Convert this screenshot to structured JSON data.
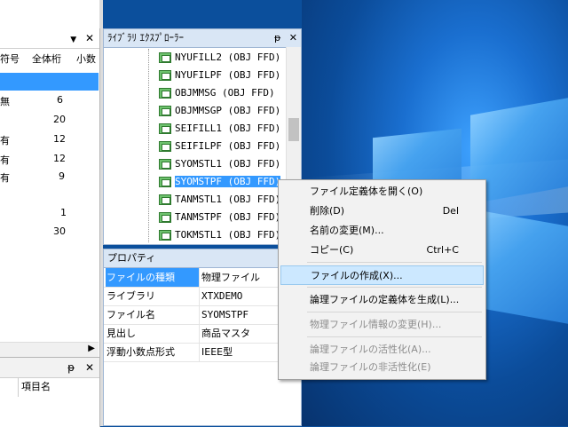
{
  "left_panel": {
    "pin": "▼",
    "close": "✕",
    "col_headers": [
      "符号",
      "全体桁",
      "小数"
    ],
    "rows": [
      {
        "c1": "",
        "c2": ""
      },
      {
        "c1": "無",
        "c2": "6"
      },
      {
        "c1": "",
        "c2": "20"
      },
      {
        "c1": "有",
        "c2": "12"
      },
      {
        "c1": "有",
        "c2": "12"
      },
      {
        "c1": "有",
        "c2": "9"
      },
      {
        "c1": "",
        "c2": ""
      },
      {
        "c1": "",
        "c2": "1"
      },
      {
        "c1": "",
        "c2": "30"
      }
    ],
    "bottom_pin": "ᵽ",
    "bottom_close": "✕",
    "bottom_col": "項目名"
  },
  "library_explorer": {
    "title": "ﾗｲﾌﾞﾗﾘ ｴｸｽﾌﾟﾛｰﾗｰ",
    "pin": "ᵽ",
    "close": "✕",
    "items": [
      {
        "label": "NYUFILL2 (OBJ  FFD)",
        "selected": false
      },
      {
        "label": "NYUFILPF (OBJ  FFD)",
        "selected": false
      },
      {
        "label": "OBJMMSG  (OBJ  FFD)",
        "selected": false
      },
      {
        "label": "OBJMMSGP (OBJ  FFD)",
        "selected": false
      },
      {
        "label": "SEIFILL1 (OBJ  FFD)",
        "selected": false
      },
      {
        "label": "SEIFILPF (OBJ  FFD)",
        "selected": false
      },
      {
        "label": "SYOMSTL1 (OBJ  FFD)",
        "selected": false
      },
      {
        "label": "SYOMSTPF (OBJ  FFD)",
        "selected": true
      },
      {
        "label": "TANMSTL1 (OBJ  FFD)",
        "selected": false
      },
      {
        "label": "TANMSTPF (OBJ  FFD)",
        "selected": false
      },
      {
        "label": "TOKMSTL1 (OBJ  FFD)",
        "selected": false
      }
    ]
  },
  "properties": {
    "title": "プロパティ",
    "rows": [
      {
        "key": "ファイルの種類",
        "value": "物理ファイル",
        "selected": true
      },
      {
        "key": "ライブラリ",
        "value": "XTXDEMO",
        "selected": false
      },
      {
        "key": "ファイル名",
        "value": "SYOMSTPF",
        "selected": false
      },
      {
        "key": "見出し",
        "value": "商品マスタ",
        "selected": false
      },
      {
        "key": "浮動小数点形式",
        "value": "IEEE型",
        "selected": false
      }
    ]
  },
  "context_menu": {
    "items": [
      {
        "label": "ファイル定義体を開く(O)",
        "shortcut": "",
        "disabled": false,
        "highlighted": false
      },
      {
        "label": "削除(D)",
        "shortcut": "Del",
        "disabled": false,
        "highlighted": false
      },
      {
        "label": "名前の変更(M)...",
        "shortcut": "",
        "disabled": false,
        "highlighted": false
      },
      {
        "label": "コピー(C)",
        "shortcut": "Ctrl+C",
        "disabled": false,
        "highlighted": false
      },
      {
        "label": "ファイルの作成(X)...",
        "shortcut": "",
        "disabled": false,
        "highlighted": true
      },
      {
        "label": "論理ファイルの定義体を生成(L)...",
        "shortcut": "",
        "disabled": false,
        "highlighted": false
      },
      {
        "label": "物理ファイル情報の変更(H)...",
        "shortcut": "",
        "disabled": true,
        "highlighted": false
      },
      {
        "label": "論理ファイルの活性化(A)...",
        "shortcut": "",
        "disabled": true,
        "highlighted": false
      },
      {
        "label": "論理ファイルの非活性化(E)",
        "shortcut": "",
        "disabled": true,
        "highlighted": false
      }
    ]
  }
}
